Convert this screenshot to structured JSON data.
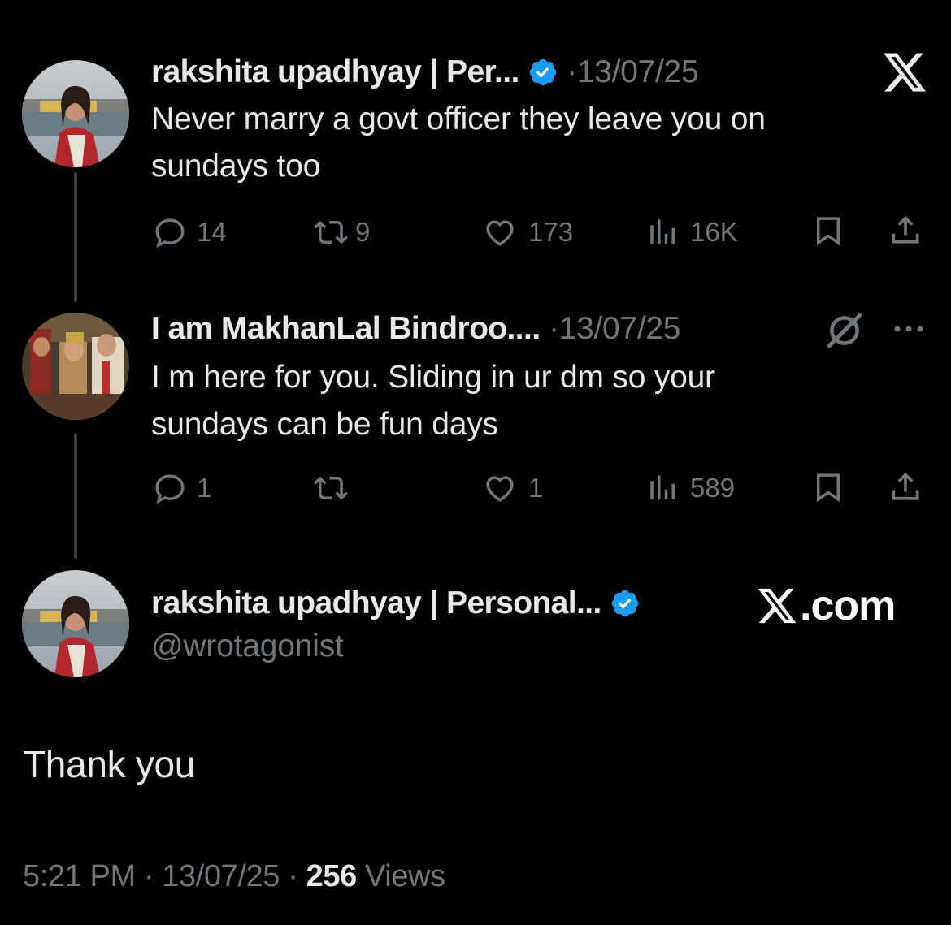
{
  "tweets": [
    {
      "author_name": "rakshita upadhyay | Per...",
      "verified": true,
      "date": "13/07/25",
      "text_line1": "Never marry a govt officer they leave you on",
      "text_line2": "sundays too",
      "replies": "14",
      "reposts": "9",
      "likes": "173",
      "views": "16K"
    },
    {
      "author_name": "I am MakhanLal Bindroo....",
      "verified": false,
      "date": "13/07/25",
      "text_line1": "I m here for you. Sliding in ur dm so your",
      "text_line2": "sundays can be fun days",
      "replies": "1",
      "reposts": "",
      "likes": "1",
      "views": "589"
    }
  ],
  "main_post": {
    "author_name": "rakshita upadhyay | Personal...",
    "verified": true,
    "handle": "@wrotagonist",
    "text": "Thank you",
    "time": "5:21 PM",
    "date": "13/07/25",
    "views_count": "256",
    "views_label": "Views"
  },
  "branding": {
    "xcom_label": ".com"
  },
  "icons": {
    "top_right": "x-logo-icon",
    "reply": "reply-icon",
    "repost": "repost-icon",
    "like": "heart-icon",
    "views": "views-icon",
    "bookmark": "bookmark-icon",
    "share": "share-icon",
    "grok": "grok-icon",
    "more": "more-icon"
  },
  "colors": {
    "background": "#000000",
    "text": "#e7e9ea",
    "muted": "#71767b",
    "verified_blue": "#1d9bf0"
  }
}
